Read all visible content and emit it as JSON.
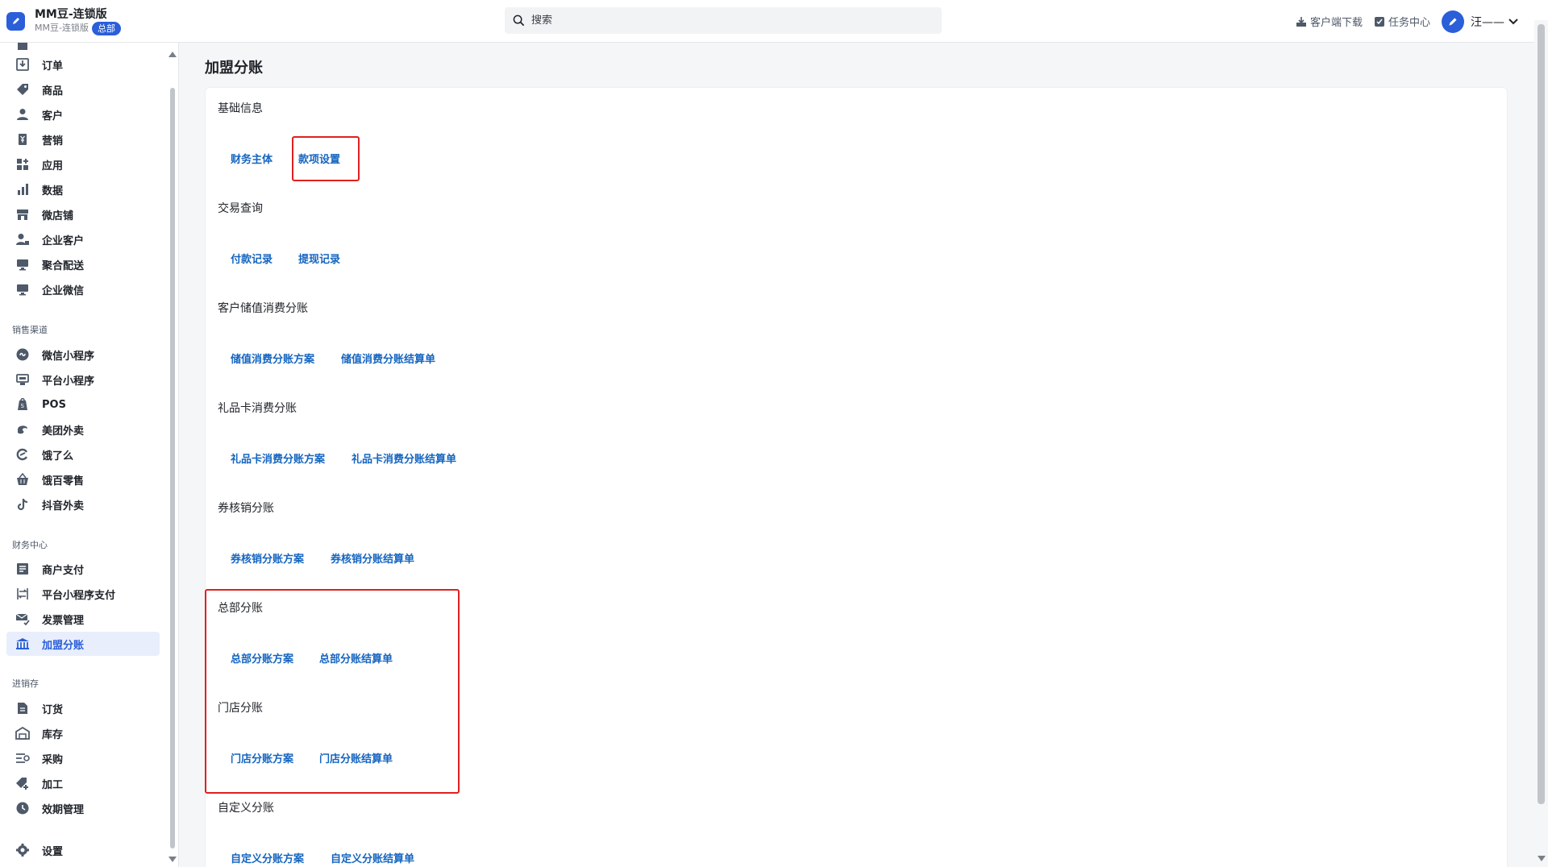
{
  "header": {
    "brand_title": "MM豆-连锁版",
    "brand_sub": "MM豆-连锁版",
    "brand_badge": "总部",
    "search_placeholder": "搜索",
    "client_download": "客户端下载",
    "task_center": "任务中心",
    "user_name": "汪——"
  },
  "sidebar": {
    "items_main": [
      {
        "label": "订单",
        "icon": "order-icon"
      },
      {
        "label": "商品",
        "icon": "tag-icon"
      },
      {
        "label": "客户",
        "icon": "person-icon"
      },
      {
        "label": "营销",
        "icon": "marketing-icon"
      },
      {
        "label": "应用",
        "icon": "apps-icon"
      },
      {
        "label": "数据",
        "icon": "chart-icon"
      },
      {
        "label": "微店铺",
        "icon": "store-icon"
      },
      {
        "label": "企业客户",
        "icon": "enterprise-customer-icon"
      },
      {
        "label": "聚合配送",
        "icon": "monitor-icon"
      },
      {
        "label": "企业微信",
        "icon": "monitor-icon"
      }
    ],
    "section_sales": "销售渠道",
    "items_sales": [
      {
        "label": "微信小程序",
        "icon": "mini-program-icon"
      },
      {
        "label": "平台小程序",
        "icon": "platform-icon"
      },
      {
        "label": "POS",
        "icon": "pos-icon"
      },
      {
        "label": "美团外卖",
        "icon": "meituan-icon"
      },
      {
        "label": "饿了么",
        "icon": "eleme-icon"
      },
      {
        "label": "饿百零售",
        "icon": "basket-icon"
      },
      {
        "label": "抖音外卖",
        "icon": "douyin-icon"
      }
    ],
    "section_finance": "财务中心",
    "items_finance": [
      {
        "label": "商户支付",
        "icon": "payment-icon"
      },
      {
        "label": "平台小程序支付",
        "icon": "transfer-icon"
      },
      {
        "label": "发票管理",
        "icon": "invoice-icon"
      },
      {
        "label": "加盟分账",
        "icon": "bank-icon",
        "active": true
      }
    ],
    "section_inventory": "进销存",
    "items_inventory": [
      {
        "label": "订货",
        "icon": "document-icon"
      },
      {
        "label": "库存",
        "icon": "warehouse-icon"
      },
      {
        "label": "采购",
        "icon": "purchase-icon"
      },
      {
        "label": "加工",
        "icon": "process-icon"
      },
      {
        "label": "效期管理",
        "icon": "clock-icon"
      }
    ],
    "settings": "设置"
  },
  "main": {
    "page_title": "加盟分账",
    "sections": [
      {
        "title": "基础信息",
        "links": [
          "财务主体",
          "款项设置"
        ]
      },
      {
        "title": "交易查询",
        "links": [
          "付款记录",
          "提现记录"
        ]
      },
      {
        "title": "客户储值消费分账",
        "links": [
          "储值消费分账方案",
          "储值消费分账结算单"
        ]
      },
      {
        "title": "礼品卡消费分账",
        "links": [
          "礼品卡消费分账方案",
          "礼品卡消费分账结算单"
        ]
      },
      {
        "title": "券核销分账",
        "links": [
          "券核销分账方案",
          "券核销分账结算单"
        ]
      },
      {
        "title": "总部分账",
        "links": [
          "总部分账方案",
          "总部分账结算单"
        ]
      },
      {
        "title": "门店分账",
        "links": [
          "门店分账方案",
          "门店分账结算单"
        ]
      },
      {
        "title": "自定义分账",
        "links": [
          "自定义分账方案",
          "自定义分账结算单"
        ]
      }
    ]
  }
}
